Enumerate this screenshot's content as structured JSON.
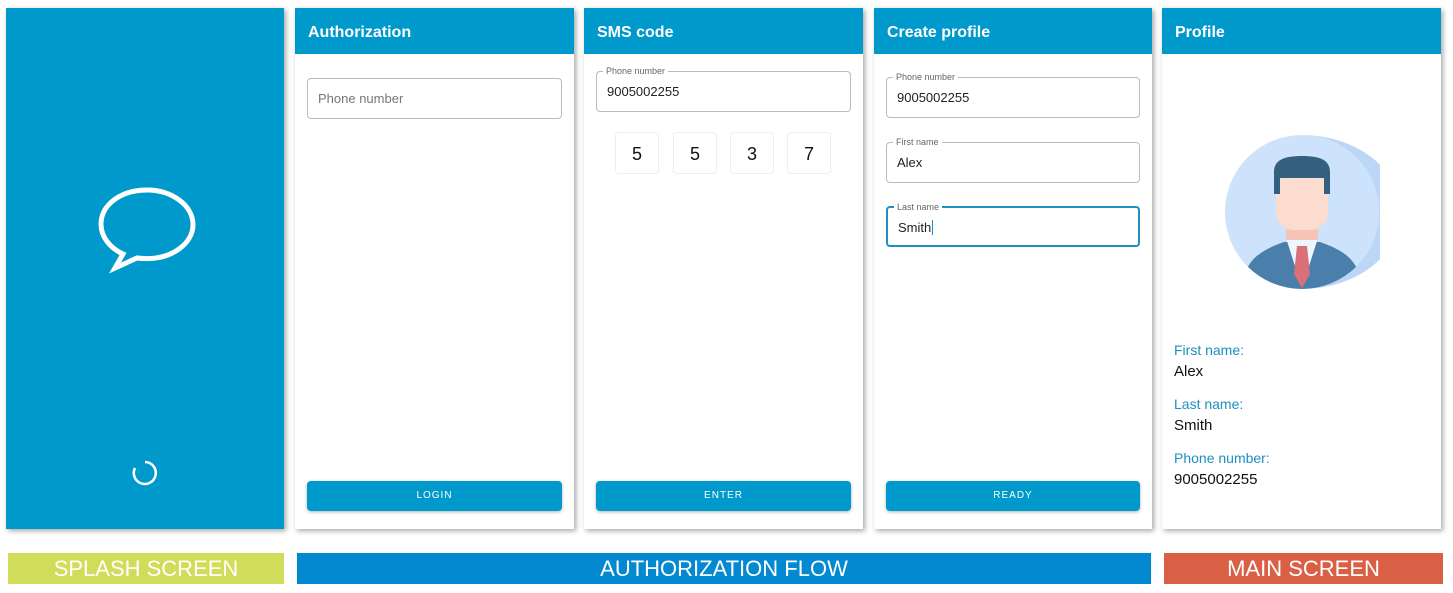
{
  "splash": {
    "band": "SPLASH SCREEN"
  },
  "auth": {
    "title": "Authorization",
    "phone_placeholder": "Phone number",
    "button": "LOGIN"
  },
  "sms": {
    "title": "SMS code",
    "phone_label": "Phone number",
    "phone_value": "9005002255",
    "code": [
      "5",
      "5",
      "3",
      "7"
    ],
    "button": "ENTER"
  },
  "create": {
    "title": "Create profile",
    "phone_label": "Phone number",
    "phone_value": "9005002255",
    "first_label": "First name",
    "first_value": "Alex",
    "last_label": "Last name",
    "last_value": "Smith",
    "button": "READY"
  },
  "profile": {
    "title": "Profile",
    "first_label": "First name:",
    "first_value": "Alex",
    "last_label": "Last name:",
    "last_value": "Smith",
    "phone_label": "Phone number:",
    "phone_value": "9005002255"
  },
  "bands": {
    "auth": "AUTHORIZATION FLOW",
    "main": "MAIN SCREEN"
  },
  "colors": {
    "primary": "#0099cc",
    "splash_band": "#d0dc5a",
    "auth_band": "#0289d0",
    "main_band": "#d95f45"
  }
}
